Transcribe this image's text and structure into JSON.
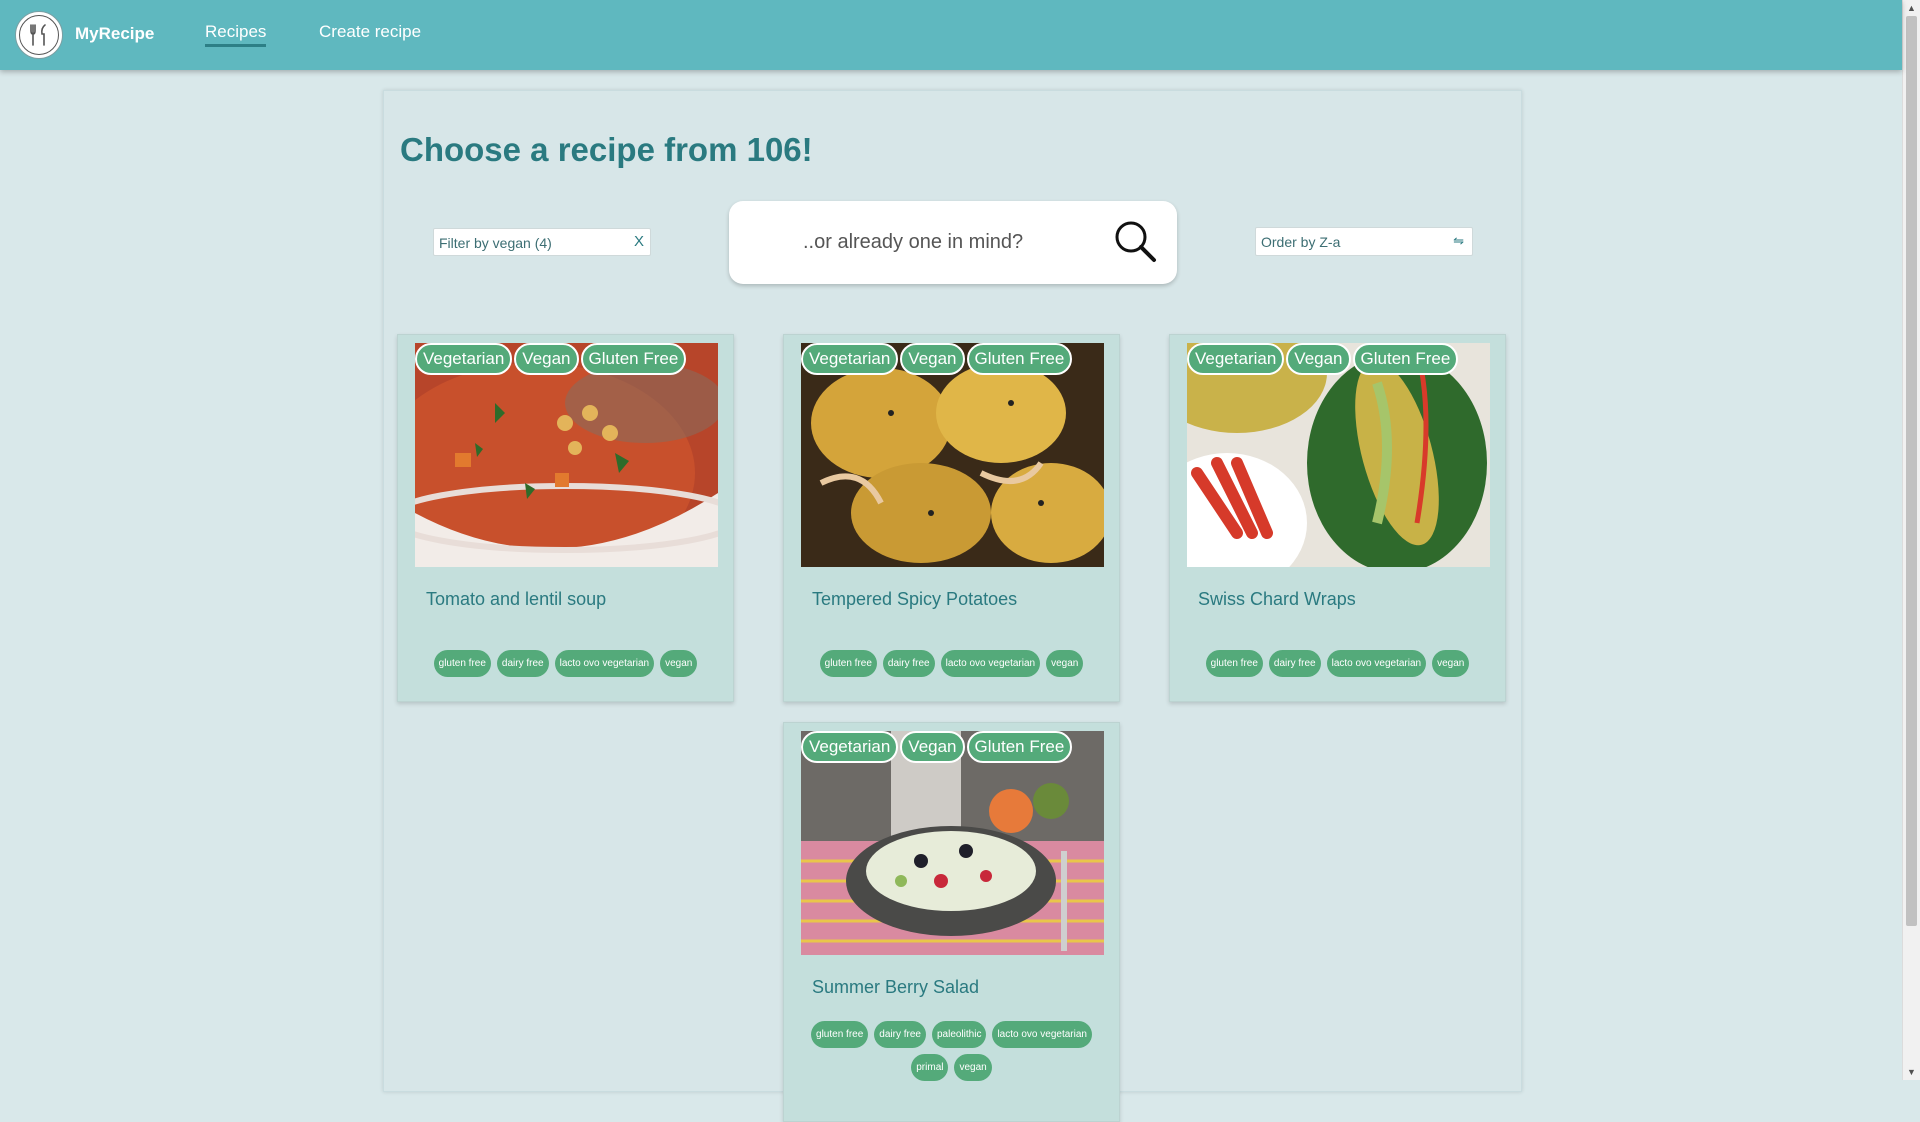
{
  "nav": {
    "brand": "MyRecipe",
    "links": [
      {
        "label": "Recipes",
        "active": true
      },
      {
        "label": "Create recipe",
        "active": false
      }
    ]
  },
  "main": {
    "title": "Choose a recipe from 106!",
    "filter": {
      "text": "Filter by vegan (4)",
      "clear": "X"
    },
    "search": {
      "placeholder": "..or already one in mind?"
    },
    "order": {
      "text": "Order by Z-a",
      "icon": "⇋"
    }
  },
  "recipes": [
    {
      "title": "Tomato and lentil soup",
      "badges": [
        "Vegetarian",
        "Vegan",
        "Gluten Free"
      ],
      "tags": [
        "gluten free",
        "dairy free",
        "lacto ovo vegetarian",
        "vegan"
      ],
      "image": "tomato-lentil-soup"
    },
    {
      "title": "Tempered Spicy Potatoes",
      "badges": [
        "Vegetarian",
        "Vegan",
        "Gluten Free"
      ],
      "tags": [
        "gluten free",
        "dairy free",
        "lacto ovo vegetarian",
        "vegan"
      ],
      "image": "spicy-potatoes"
    },
    {
      "title": "Swiss Chard Wraps",
      "badges": [
        "Vegetarian",
        "Vegan",
        "Gluten Free"
      ],
      "tags": [
        "gluten free",
        "dairy free",
        "lacto ovo vegetarian",
        "vegan"
      ],
      "image": "chard-wraps"
    },
    {
      "title": "Summer Berry Salad",
      "badges": [
        "Vegetarian",
        "Vegan",
        "Gluten Free"
      ],
      "tags": [
        "gluten free",
        "dairy free",
        "paleolithic",
        "lacto ovo vegetarian",
        "primal",
        "vegan"
      ],
      "image": "berry-salad"
    }
  ],
  "colors": {
    "navbar": "#5fb8bf",
    "accent": "#2a7a80",
    "badge": "#54aa7a",
    "card": "#c4dfdc"
  }
}
